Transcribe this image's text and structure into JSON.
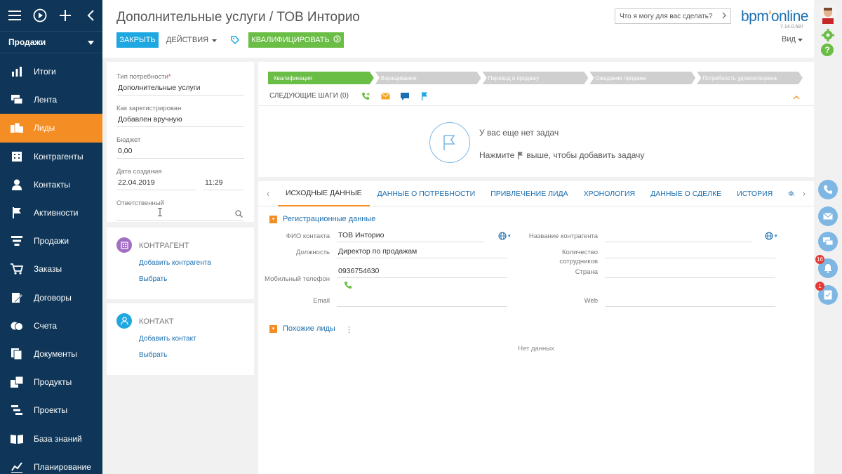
{
  "nav": {
    "section": "Продажи",
    "items": [
      {
        "label": "Итоги",
        "icon": "bar-chart-icon",
        "active": false
      },
      {
        "label": "Лента",
        "icon": "feed-icon",
        "active": false
      },
      {
        "label": "Лиды",
        "icon": "leads-icon",
        "active": true
      },
      {
        "label": "Контрагенты",
        "icon": "building-icon",
        "active": false
      },
      {
        "label": "Контакты",
        "icon": "person-icon",
        "active": false
      },
      {
        "label": "Активности",
        "icon": "flag-icon",
        "active": false
      },
      {
        "label": "Продажи",
        "icon": "funnel-icon",
        "active": false
      },
      {
        "label": "Заказы",
        "icon": "cart-icon",
        "active": false
      },
      {
        "label": "Договоры",
        "icon": "contract-icon",
        "active": false
      },
      {
        "label": "Счета",
        "icon": "coins-icon",
        "active": false
      },
      {
        "label": "Документы",
        "icon": "documents-icon",
        "active": false
      },
      {
        "label": "Продукты",
        "icon": "products-icon",
        "active": false
      },
      {
        "label": "Проекты",
        "icon": "projects-icon",
        "active": false
      },
      {
        "label": "База знаний",
        "icon": "book-icon",
        "active": false
      },
      {
        "label": "Планирование",
        "icon": "planning-icon",
        "active": false
      }
    ]
  },
  "header": {
    "title": "Дополнительные услуги / ТОВ Инторио",
    "close_label": "Закрыть",
    "actions_label": "Действия",
    "qualify_label": "Квалифицировать",
    "search_placeholder": "Что я могу для вас сделать?",
    "logo_a": "bpm",
    "logo_b": "online",
    "version": "7.14.0.597",
    "view_label": "Вид"
  },
  "fields": {
    "need_type_label": "Тип потребности",
    "need_type_value": "Дополнительные услуги",
    "registered_label": "Как зарегистрирован",
    "registered_value": "Добавлен вручную",
    "budget_label": "Бюджет",
    "budget_value": "0,00",
    "created_label": "Дата создания",
    "created_date": "22.04.2019",
    "created_time": "11:29",
    "owner_label": "Ответственный",
    "owner_value": ""
  },
  "account": {
    "header": "Контрагент",
    "add_link": "Добавить контрагента",
    "select_link": "Выбрать"
  },
  "contact": {
    "header": "Контакт",
    "add_link": "Добавить контакт",
    "select_link": "Выбрать"
  },
  "stages": [
    {
      "label": "Квалификация",
      "state": "active"
    },
    {
      "label": "Взращивание",
      "state": "inactive"
    },
    {
      "label": "Перевод в продажу",
      "state": "inactive"
    },
    {
      "label": "Ожидание продажи",
      "state": "inactive"
    },
    {
      "label": "Потребность удовлетворена",
      "state": "inactive"
    }
  ],
  "next_steps": {
    "label": "Следующие шаги (0)",
    "empty_title": "У вас еще нет задач",
    "empty_hint_prefix": "Нажмите",
    "empty_hint_suffix": "выше, чтобы добавить задачу"
  },
  "tabs": [
    {
      "label": "Исходные данные",
      "active": true
    },
    {
      "label": "Данные о потребности",
      "active": false
    },
    {
      "label": "Привлечение лида",
      "active": false
    },
    {
      "label": "Хронология",
      "active": false
    },
    {
      "label": "Данные о сделке",
      "active": false
    },
    {
      "label": "История",
      "active": false
    },
    {
      "label": "Файлы и примечан",
      "active": false
    }
  ],
  "registration": {
    "group_title": "Регистрационные данные",
    "contact_name_label": "ФИО контакта",
    "contact_name_value": "ТОВ Инторио",
    "position_label": "Должность",
    "position_value": "Директор по продажам",
    "mobile_label": "Мобильный телефон",
    "mobile_value": "0936754630",
    "email_label": "Email",
    "email_value": "",
    "account_name_label": "Название контрагента",
    "account_name_value": "",
    "employees_label": "Количество сотрудников",
    "employees_value": "",
    "country_label": "Страна",
    "country_value": "",
    "web_label": "Web",
    "web_value": ""
  },
  "similar": {
    "group_title": "Похожие лиды",
    "no_data": "Нет данных"
  },
  "rail": {
    "notifications_count": "16",
    "tasks_count": "1"
  },
  "colors": {
    "nav_bg": "#0f3658",
    "accent_orange": "#f58d25",
    "primary_blue": "#1fa7e1",
    "success_green": "#6abd45",
    "link_blue": "#1b6fb0"
  }
}
